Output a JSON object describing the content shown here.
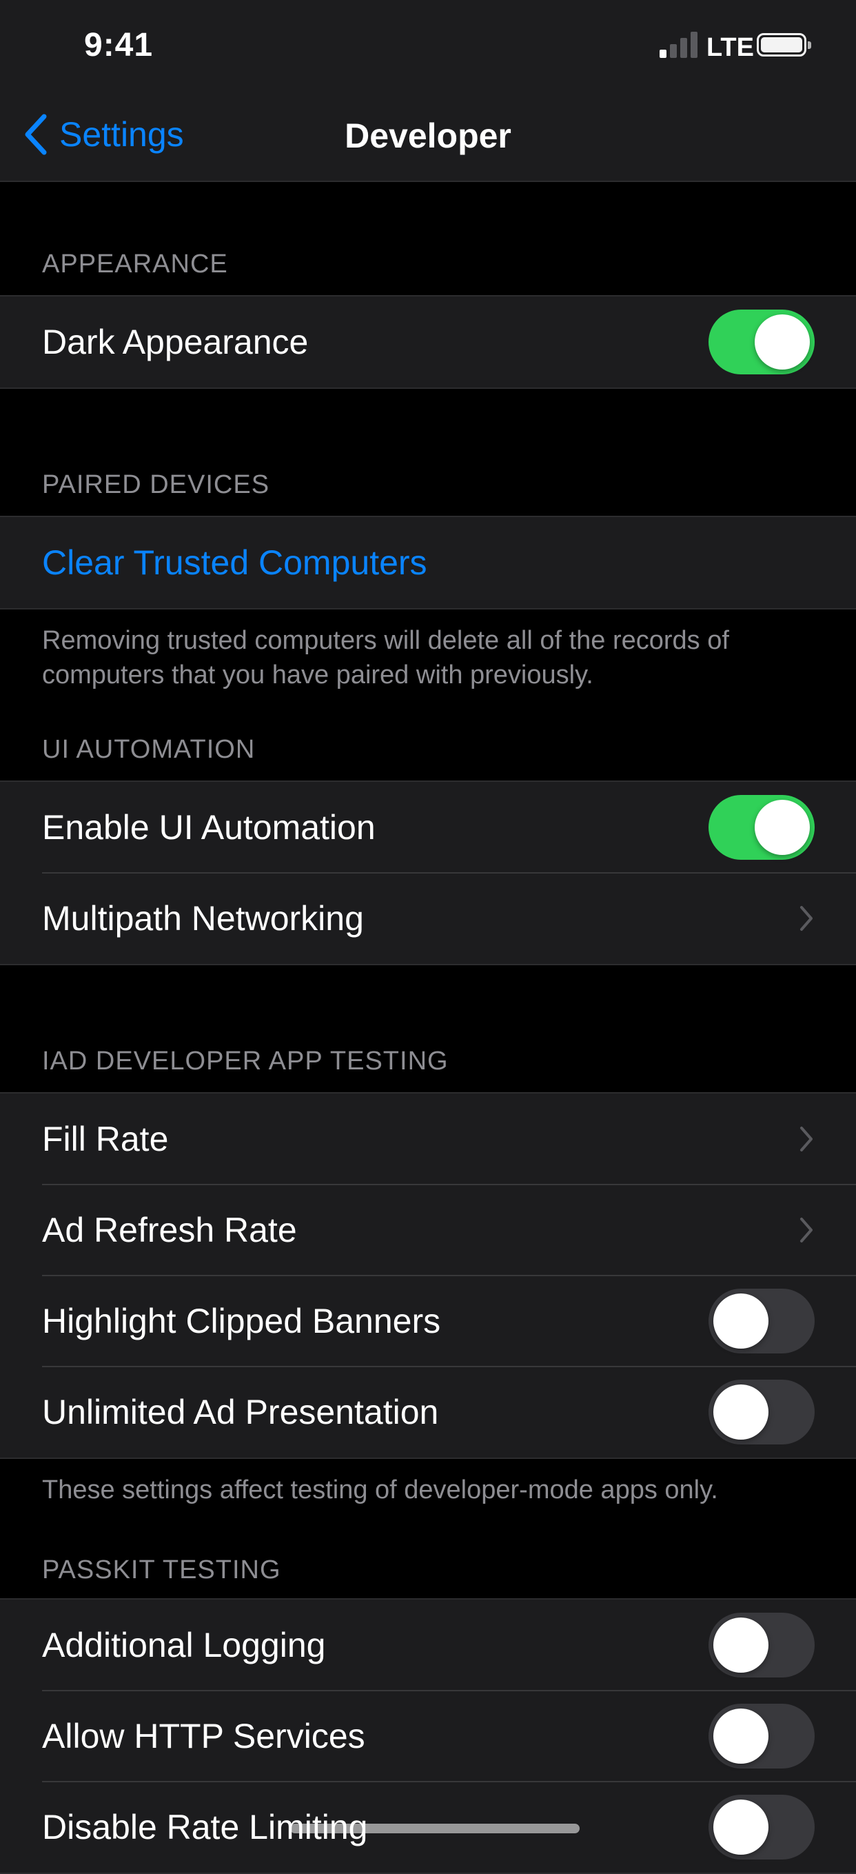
{
  "status_bar": {
    "time": "9:41",
    "network": "LTE",
    "signal_bars": 4,
    "signal_active_bars": 1
  },
  "nav": {
    "back_label": "Settings",
    "title": "Developer"
  },
  "colors": {
    "accent": "#0a84ff",
    "toggle_on": "#30d158",
    "toggle_off": "#39393d",
    "background": "#000000",
    "cell": "#1c1c1e",
    "secondary_text": "#8e8e93"
  },
  "sections": {
    "appearance": {
      "header": "APPEARANCE",
      "rows": [
        {
          "label": "Dark Appearance",
          "control": "toggle",
          "on": true
        }
      ]
    },
    "paired_devices": {
      "header": "PAIRED DEVICES",
      "rows": [
        {
          "label": "Clear Trusted Computers",
          "control": "link"
        }
      ],
      "footer": "Removing trusted computers will delete all of the records of computers that you have paired with previously."
    },
    "ui_automation": {
      "header": "UI AUTOMATION",
      "rows": [
        {
          "label": "Enable UI Automation",
          "control": "toggle",
          "on": true
        },
        {
          "label": "Multipath Networking",
          "control": "disclosure"
        }
      ]
    },
    "iad_testing": {
      "header": "IAD DEVELOPER APP TESTING",
      "rows": [
        {
          "label": "Fill Rate",
          "control": "disclosure"
        },
        {
          "label": "Ad Refresh Rate",
          "control": "disclosure"
        },
        {
          "label": "Highlight Clipped Banners",
          "control": "toggle",
          "on": false
        },
        {
          "label": "Unlimited Ad Presentation",
          "control": "toggle",
          "on": false
        }
      ],
      "footer": "These settings affect testing of developer-mode apps only."
    },
    "passkit_testing": {
      "header": "PASSKIT TESTING",
      "rows": [
        {
          "label": "Additional Logging",
          "control": "toggle",
          "on": false
        },
        {
          "label": "Allow HTTP Services",
          "control": "toggle",
          "on": false
        },
        {
          "label": "Disable Rate Limiting",
          "control": "toggle",
          "on": false
        }
      ]
    }
  }
}
